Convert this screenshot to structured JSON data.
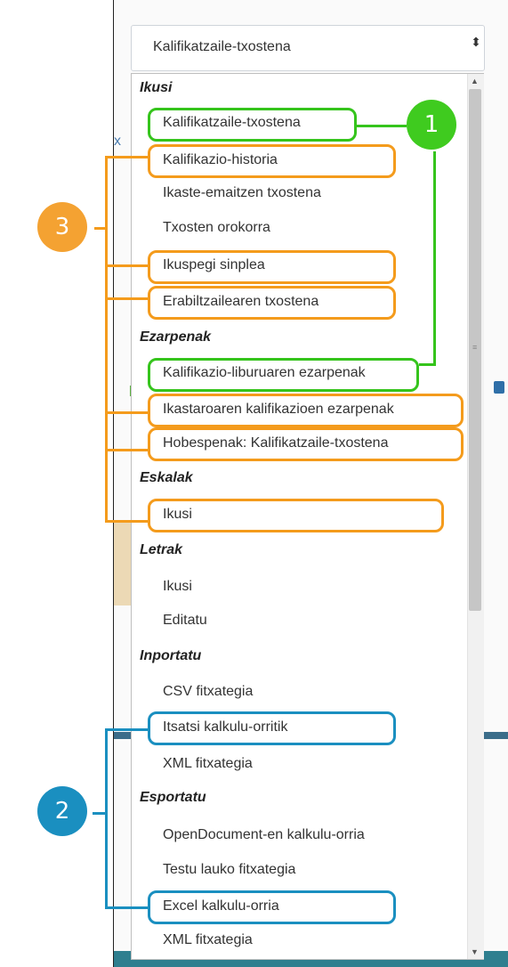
{
  "select": {
    "value": "Kalifikatzaile-txostena",
    "caret": "⬍"
  },
  "background": {
    "close_glyph": "x"
  },
  "dropdown": {
    "groups": [
      {
        "label": "Ikusi",
        "items": [
          "Kalifikatzaile-txostena",
          "Kalifikazio-historia",
          "Ikaste-emaitzen txostena",
          "Txosten orokorra",
          "Ikuspegi sinplea",
          "Erabiltzailearen txostena"
        ]
      },
      {
        "label": "Ezarpenak",
        "items": [
          "Kalifikazio-liburuaren ezarpenak",
          "Ikastaroaren kalifikazioen ezarpenak",
          "Hobespenak: Kalifikatzaile-txostena"
        ]
      },
      {
        "label": "Eskalak",
        "items": [
          "Ikusi"
        ]
      },
      {
        "label": "Letrak",
        "items": [
          "Ikusi",
          "Editatu"
        ]
      },
      {
        "label": "Inportatu",
        "items": [
          "CSV fitxategia",
          "Itsatsi kalkulu-orritik",
          "XML fitxategia"
        ]
      },
      {
        "label": "Esportatu",
        "items": [
          "OpenDocument-en kalkulu-orria",
          "Testu lauko fitxategia",
          "Excel kalkulu-orria",
          "XML fitxategia"
        ]
      }
    ]
  },
  "badges": {
    "one": "1",
    "two": "2",
    "three": "3"
  },
  "colors": {
    "green": "#35c41c",
    "orange": "#f49b1c",
    "blue": "#1a8fc0"
  },
  "scrollbar": {
    "up": "▲",
    "down": "▼",
    "grip": "≡"
  }
}
